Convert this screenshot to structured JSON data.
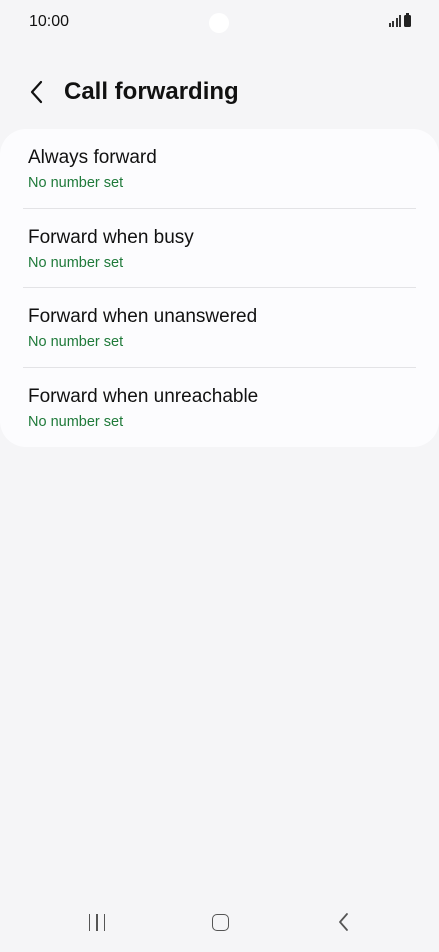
{
  "status_bar": {
    "time": "10:00"
  },
  "header": {
    "title": "Call forwarding",
    "back_icon": "chevron-left-icon"
  },
  "list": {
    "items": [
      {
        "title": "Always forward",
        "subtitle": "No number set"
      },
      {
        "title": "Forward when busy",
        "subtitle": "No number set"
      },
      {
        "title": "Forward when unanswered",
        "subtitle": "No number set"
      },
      {
        "title": "Forward when unreachable",
        "subtitle": "No number set"
      }
    ]
  },
  "nav_bar": {
    "recents_icon": "recents-icon",
    "home_icon": "home-icon",
    "back_icon": "back-icon"
  },
  "colors": {
    "background": "#f5f5f7",
    "card": "#fcfcfe",
    "subtitle_green": "#1f7a3a"
  }
}
